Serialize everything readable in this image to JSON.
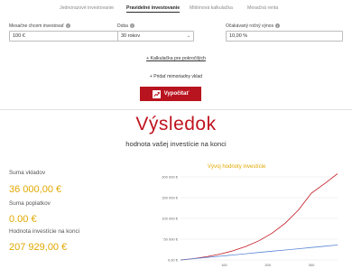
{
  "tabs": [
    "Jednorazové investovanie",
    "Pravidelné investovanie",
    "Mitiónová kalkulačka",
    "Mesačná renta"
  ],
  "form": {
    "monthly": {
      "label": "Mesačne chcem investovať",
      "value": "100 €"
    },
    "period": {
      "label": "Doba",
      "value": "30 rokov"
    },
    "yield": {
      "label": "Očakávaný ročný výnos",
      "value": "10,00 %"
    }
  },
  "advanced_link": "+ Kalkulačka pre pokročilých",
  "add_deposit": "+ Pridať mimoriadny vklad",
  "calc_button": "Vypočítať",
  "result": {
    "title": "Výsledok",
    "subtitle": "hodnota vašej investície na konci",
    "deposits_label": "Suma vkladov",
    "deposits_value": "36 000,00 €",
    "fees_label": "Suma poplatkov",
    "fees_value": "0.00 €",
    "end_label": "Hodnota investície na konci",
    "end_value": "207 929,00 €"
  },
  "colors": {
    "accent": "#b8141f",
    "gold": "#e0a800",
    "investment_line": "#c0141e",
    "deposits_line": "#5b86d6"
  },
  "chart_data": {
    "type": "line",
    "title": "Vývoj hodnoty investície",
    "xlabel": "",
    "ylabel": "",
    "xlim": [
      0,
      360
    ],
    "ylim": [
      0,
      200000
    ],
    "x_ticks": [
      100,
      200,
      300
    ],
    "y_ticks": [
      0,
      50000,
      100000,
      150000,
      200000
    ],
    "y_tick_labels": [
      "0,00 €",
      "50 000 €",
      "100 000 €",
      "150 000 €",
      "200 000 €"
    ],
    "series": [
      {
        "x": [
          0,
          30,
          60,
          90,
          120,
          150,
          180,
          210,
          240,
          270,
          300,
          330,
          360
        ],
        "values": [
          0,
          3200,
          7800,
          13900,
          21900,
          32500,
          46400,
          64600,
          88500,
          119800,
          160900,
          183500,
          207929
        ]
      },
      {
        "x": [
          0,
          30,
          60,
          90,
          120,
          150,
          180,
          210,
          240,
          270,
          300,
          330,
          360
        ],
        "values": [
          0,
          3000,
          6000,
          9000,
          12000,
          15000,
          18000,
          21000,
          24000,
          27000,
          30000,
          33000,
          36000
        ]
      }
    ]
  }
}
